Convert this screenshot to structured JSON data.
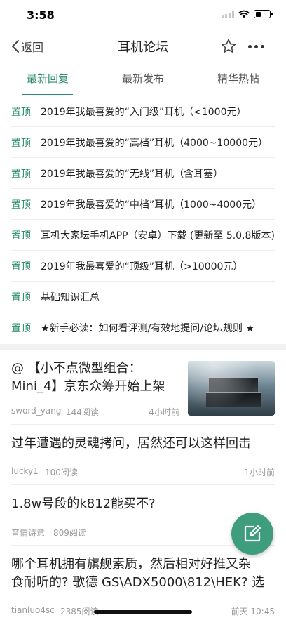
{
  "status": {
    "time": "3:58"
  },
  "nav": {
    "back_label": "返回",
    "title": "耳机论坛"
  },
  "tabs": [
    {
      "label": "最新回复",
      "active": true
    },
    {
      "label": "最新发布",
      "active": false
    },
    {
      "label": "精华热帖",
      "active": false
    }
  ],
  "pinned": {
    "tag": "置顶",
    "items": [
      "2019年我最喜爱的“入门级”耳机（<1000元）",
      "2019年我最喜爱的“高档”耳机（4000~10000元）",
      "2019年我最喜爱的“无线”耳机（含耳塞）",
      "2019年我最喜爱的“中档”耳机（1000~4000元）",
      "耳机大家坛手机APP（安卓）下载 (更新至 5.0.8版本)",
      "2019年我最喜爱的“顶级”耳机（>10000元）",
      "基础知识汇总",
      "★新手必读：如何看评测/有效地提问/论坛规则 ★"
    ]
  },
  "posts": [
    {
      "title_line1": "@ 【小不点微型组合：",
      "title_line2": "Mini_4】京东众筹开始上架",
      "author": "sword_yang",
      "reads": "144阅读",
      "time": "4小时前"
    },
    {
      "title_line1": "过年遭遇的灵魂拷问，居然还可以这样回击",
      "author": "lucky1",
      "reads": "100阅读",
      "time": "1小时前"
    },
    {
      "title_line1": "1.8w号段的k812能买不?",
      "author": "音情诗意",
      "reads": "809阅读",
      "time": ""
    },
    {
      "title_line1": "哪个耳机拥有旗舰素质，然后相对好推又杂",
      "title_line2": "食耐听的? 歌德 GS\\ADX5000\\812\\HEK? 选",
      "author": "tianluo4sc",
      "reads": "2385阅读",
      "time": "前天 10:45"
    }
  ],
  "colors": {
    "accent": "#2b8c6e",
    "fab": "#3d9d7d"
  },
  "icons": [
    "wifi-icon",
    "battery-icon",
    "back-chevron-icon",
    "star-icon",
    "more-icon",
    "compose-icon"
  ]
}
